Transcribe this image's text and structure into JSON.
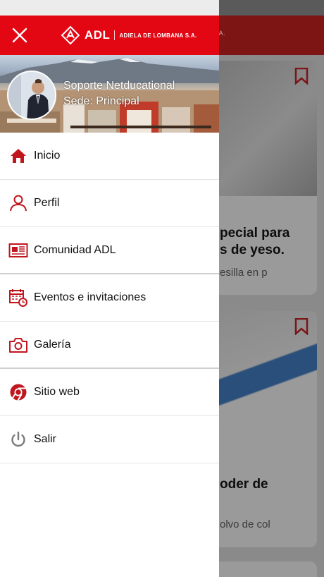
{
  "background": {
    "header_text": "A.",
    "cards": [
      {
        "title_line1": "pecial para",
        "title_line2": "s de yeso.",
        "subtitle": "esilla en p"
      },
      {
        "title_line1": "oder de",
        "subtitle": "olvo de col"
      }
    ]
  },
  "drawer": {
    "brand": {
      "name": "ADL",
      "full": "ADIELA DE LOMBANA S.A."
    },
    "profile": {
      "name": "Soporte Netducational",
      "site": "Sede: Principal"
    },
    "menu": [
      {
        "label": "Inicio",
        "icon": "home-icon"
      },
      {
        "label": "Perfil",
        "icon": "user-icon"
      },
      {
        "label": "Comunidad ADL",
        "icon": "newspaper-icon"
      },
      {
        "label": "Eventos e invitaciones",
        "icon": "calendar-clock-icon"
      },
      {
        "label": "Galería",
        "icon": "camera-icon"
      },
      {
        "label": "Sitio web",
        "icon": "chrome-icon"
      },
      {
        "label": "Salir",
        "icon": "power-icon"
      }
    ]
  },
  "colors": {
    "brand_red": "#e30613",
    "icon_red": "#c0161e",
    "power_gray": "#7a7a7a"
  }
}
